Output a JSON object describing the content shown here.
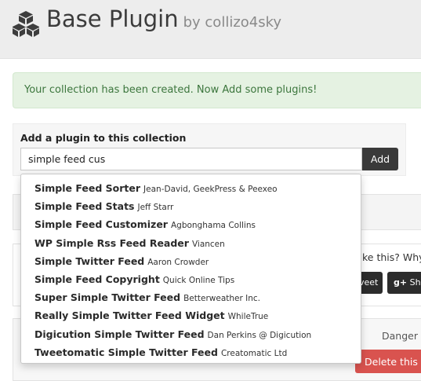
{
  "header": {
    "title": "Base Plugin",
    "byline": "by collizo4sky",
    "logo_icon": "cubes-icon"
  },
  "alert": {
    "message": "Your collection has been created. Now Add some plugins!"
  },
  "add_plugin": {
    "label": "Add a plugin to this collection",
    "input_value": "simple feed cus",
    "button_label": "Add"
  },
  "suggestions": [
    {
      "name": "Simple Feed Sorter",
      "author": "Jean-David, GeekPress & Peexeo"
    },
    {
      "name": "Simple Feed Stats",
      "author": "Jeff Starr"
    },
    {
      "name": "Simple Feed Customizer",
      "author": "Agbonghama Collins"
    },
    {
      "name": "WP Simple Rss Feed Reader",
      "author": "Viancen"
    },
    {
      "name": "Simple Twitter Feed",
      "author": "Aaron Crowder"
    },
    {
      "name": "Simple Feed Copyright",
      "author": "Quick Online Tips"
    },
    {
      "name": "Super Simple Twitter Feed",
      "author": "Betterweather Inc."
    },
    {
      "name": "Really Simple Twitter Feed Widget",
      "author": "WhileTrue"
    },
    {
      "name": "Digicution Simple Twitter Feed",
      "author": "Dan Perkins @ Digicution"
    },
    {
      "name": "Tweetomatic Simple Twitter Feed",
      "author": "Creatomatic Ltd"
    }
  ],
  "background": {
    "share_prompt": "ke this? Why n",
    "tweet_label": "veet",
    "share_label": "Sha",
    "share_icon": "google-plus-icon",
    "danger_label": "Danger Z",
    "delete_label": "Delete this c"
  }
}
